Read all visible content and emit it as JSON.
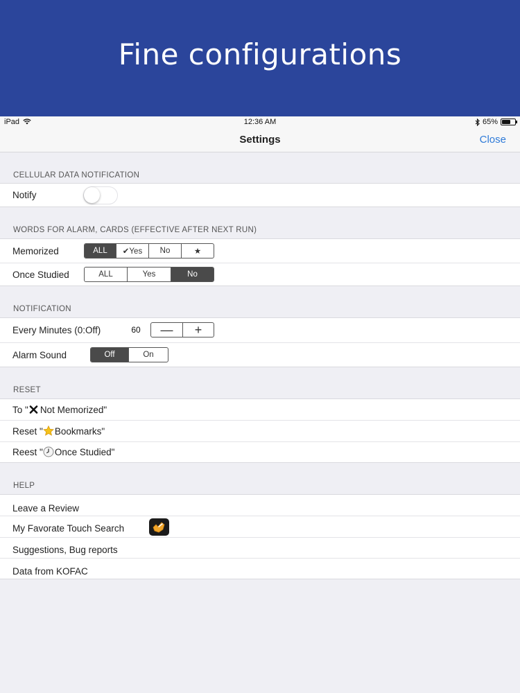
{
  "banner": {
    "title": "Fine configurations"
  },
  "status_bar": {
    "device": "iPad",
    "time": "12:36 AM",
    "battery": "65%",
    "battery_level": 0.65
  },
  "nav": {
    "title": "Settings",
    "close": "Close"
  },
  "sections": {
    "cellular": {
      "header": "CELLULAR DATA NOTIFICATION",
      "notify_label": "Notify",
      "notify_on": false
    },
    "words": {
      "header": "WORDS FOR ALARM, CARDS (EFFECTIVE AFTER NEXT RUN)",
      "memorized": {
        "label": "Memorized",
        "options": [
          "ALL",
          "✔Yes",
          "No",
          "★"
        ],
        "selected": "ALL"
      },
      "once_studied": {
        "label": "Once Studied",
        "options": [
          "ALL",
          "Yes",
          "No"
        ],
        "selected": "No"
      }
    },
    "notification": {
      "header": "NOTIFICATION",
      "every_minutes": {
        "label": "Every Minutes (0:Off)",
        "value": "60",
        "minus": "—",
        "plus": "+"
      },
      "alarm_sound": {
        "label": "Alarm Sound",
        "options": [
          "Off",
          "On"
        ],
        "selected": "Off"
      }
    },
    "reset": {
      "header": "RESET",
      "items": [
        {
          "prefix": "To \"",
          "icon": "x-mark-icon",
          "text": "Not Memorized\""
        },
        {
          "prefix": "Reset \"",
          "icon": "star-icon",
          "text": "Bookmarks\""
        },
        {
          "prefix": "Reest \"",
          "icon": "clock-icon",
          "text": "Once Studied\""
        }
      ]
    },
    "help": {
      "header": "HELP",
      "items": [
        "Leave a Review",
        "My Favorate Touch Search",
        "Suggestions, Bug reports",
        "Data from KOFAC"
      ],
      "touch_search_icon": "hand-pointer-app-icon"
    }
  },
  "colors": {
    "banner": "#2b459b",
    "accent": "#2f7bd8",
    "segment_selected": "#4a4a4a"
  }
}
